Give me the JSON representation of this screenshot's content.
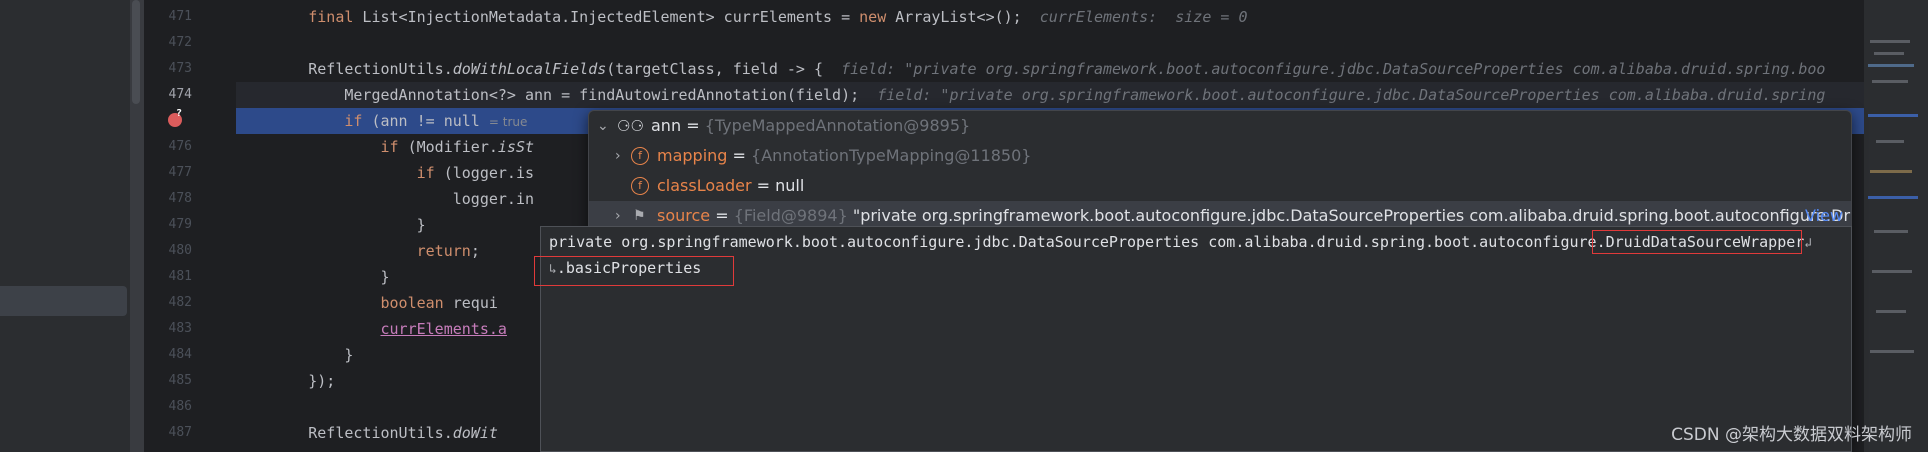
{
  "editor": {
    "line_numbers": [
      "471",
      "472",
      "473",
      "474",
      "475",
      "476",
      "477",
      "478",
      "479",
      "480",
      "481",
      "482",
      "483",
      "484",
      "485",
      "486",
      "487"
    ],
    "lines": {
      "l471_kw1": "final",
      "l471_type": " List<InjectionMetadata.InjectedElement> currElements = ",
      "l471_kw2": "new",
      "l471_rest": " ArrayList<>();",
      "l471_hint": "currElements:  size = 0",
      "l473_obj": "ReflectionUtils.",
      "l473_method": "doWithLocalFields",
      "l473_rest": "(targetClass, field -> {",
      "l473_hint": "field: \"private org.springframework.boot.autoconfigure.jdbc.DataSourceProperties com.alibaba.druid.spring.boo",
      "l474_code": "MergedAnnotation<?> ann = findAutowiredAnnotation(field);",
      "l474_hint": "field: \"private org.springframework.boot.autoconfigure.jdbc.DataSourceProperties com.alibaba.druid.spring",
      "l475_kw": "if",
      "l475_code": " (ann != null",
      "l475_hint": "= true",
      "l476_kw": "if",
      "l476_code": " (Modifier.",
      "l476_method": "isSt",
      "l477_kw": "if",
      "l477_code": " (logger.is",
      "l478_code": "logger.in",
      "l479_code": "}",
      "l480_kw": "return",
      "l480_code": ";",
      "l481_code": "}",
      "l482_kw": "boolean",
      "l482_code": " requi",
      "l483_field": "currElements.a",
      "l484_code": "}",
      "l485_code": "});",
      "l487_obj": "ReflectionUtils.",
      "l487_method": "doWit"
    }
  },
  "debugger": {
    "root": {
      "name": "ann",
      "value": "{TypeMappedAnnotation@9895}"
    },
    "children": [
      {
        "icon_letter": "f",
        "name": "mapping",
        "value": "{AnnotationTypeMapping@11850}"
      },
      {
        "icon_letter": "f",
        "name": "classLoader",
        "value": "null"
      },
      {
        "name": "source",
        "value_ref": "{Field@9894}",
        "value_text": " \"private org.springframework.boot.autoconfigure.jdbc.DataSourceProperties com.alibaba.druid.spring.boot.autoconfigure.Dr",
        "link": "View"
      }
    ],
    "eq": "="
  },
  "tooltip": {
    "line1_prefix": "private org.springframework.boot.autoconfigure.jdbc.DataSourceProperties com.alibaba.druid.spring.boot.autoconfigure.",
    "line1_highlight": "DruidDataSourceWrapper",
    "line2": ".basicProperties"
  },
  "watermark": "CSDN @架构大数据双料架构师",
  "icons": {
    "wrap": "soft-wrap-icon",
    "breakpoint": "breakpoint-icon",
    "watch": "glasses-icon"
  },
  "colors": {
    "execution_line": "#2d4a8a",
    "breakpoint": "#db5c5c",
    "keyword": "#cf8e6d",
    "field": "#e8844a",
    "highlight_box": "#e03a3a"
  }
}
